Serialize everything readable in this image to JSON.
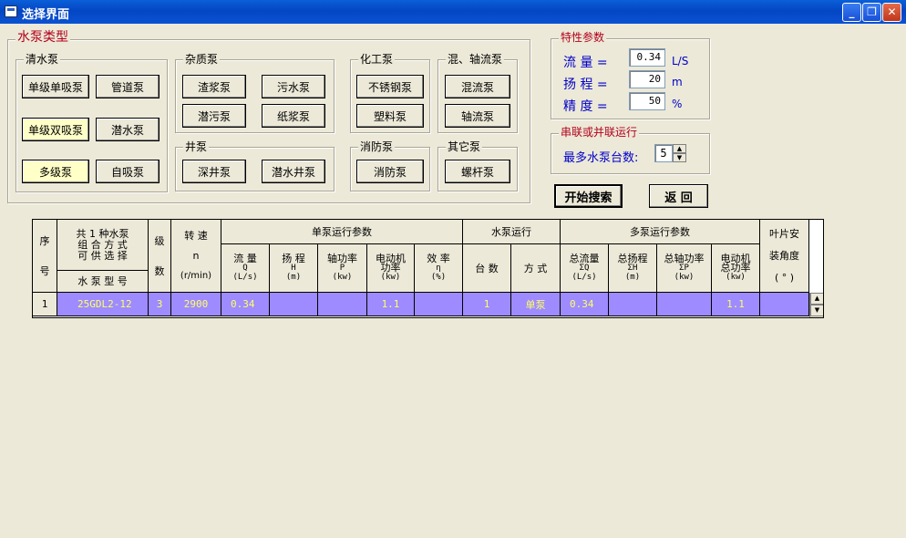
{
  "window": {
    "title": "选择界面",
    "controls": {
      "minimize": "_",
      "restore": "❐",
      "close": "✕"
    }
  },
  "pump_type": {
    "title": "水泵类型",
    "clean": {
      "title": "清水泵",
      "b1": "单级单吸泵",
      "b2": "管道泵",
      "b3": "单级双吸泵",
      "b4": "潜水泵",
      "b5": "多级泵",
      "b6": "自吸泵"
    },
    "impurity": {
      "title": "杂质泵",
      "b1": "渣浆泵",
      "b2": "污水泵",
      "b3": "潜污泵",
      "b4": "纸浆泵"
    },
    "chemical": {
      "title": "化工泵",
      "b1": "不锈钢泵",
      "b2": "塑料泵"
    },
    "mixed": {
      "title": "混、轴流泵",
      "b1": "混流泵",
      "b2": "轴流泵"
    },
    "well": {
      "title": "井泵",
      "b1": "深井泵",
      "b2": "潜水井泵"
    },
    "fire": {
      "title": "消防泵",
      "b1": "消防泵"
    },
    "other": {
      "title": "其它泵",
      "b1": "螺杆泵"
    }
  },
  "params": {
    "title": "特性参数",
    "flow_label": "流  量 =",
    "flow_value": "0.34",
    "flow_unit": "L/S",
    "head_label": "扬  程 =",
    "head_value": "20",
    "head_unit": "m",
    "prec_label": "精  度 =",
    "prec_value": "50",
    "prec_unit": "%"
  },
  "series": {
    "title": "串联或并联运行",
    "max_label": "最多水泵台数:",
    "max_value": "5",
    "up": "▲",
    "down": "▼"
  },
  "actions": {
    "search": "开始搜索",
    "back": "返 回"
  },
  "grid": {
    "h_seq": [
      "序",
      "号"
    ],
    "h_combo": [
      "共 1 种水泵",
      "组 合 方 式",
      "可 供 选 择"
    ],
    "h_model": "水 泵 型 号",
    "h_stage": [
      "级",
      "数"
    ],
    "h_speed": [
      "转  速",
      "n",
      "(r/min)"
    ],
    "h_single": "单泵运行参数",
    "h_flow": [
      "流  量",
      "Q",
      "(L/s)"
    ],
    "h_head": [
      "扬  程",
      "H",
      "(m)"
    ],
    "h_shaft": [
      "轴功率",
      "P",
      "(kw)"
    ],
    "h_motor": [
      "电动机",
      "功率",
      "(kw)"
    ],
    "h_eff": [
      "效  率",
      "η",
      "(%)"
    ],
    "h_run": "水泵运行",
    "h_count": "台  数",
    "h_mode": "方  式",
    "h_multi": "多泵运行参数",
    "h_tflow": [
      "总流量",
      "ΣQ",
      "(L/s)"
    ],
    "h_thead": [
      "总扬程",
      "ΣH",
      "(m)"
    ],
    "h_tshaft": [
      "总轴功率",
      "ΣP",
      "(kw)"
    ],
    "h_tmotor": [
      "电动机",
      "总功率",
      "(kw)"
    ],
    "h_angle": [
      "叶片安",
      "装角度",
      "( ° )"
    ],
    "rows": [
      {
        "seq": "1",
        "model": "25GDL2-12",
        "stage": "3",
        "speed": "2900",
        "flow": "0.34",
        "head": "",
        "shaft": "",
        "motor": "1.1",
        "eff": "",
        "count": "1",
        "mode": "单泵",
        "tflow": "0.34",
        "thead": "",
        "tshaft": "",
        "tmotor": "1.1",
        "angle": ""
      }
    ],
    "scroll_up": "▲",
    "scroll_down": "▼"
  }
}
